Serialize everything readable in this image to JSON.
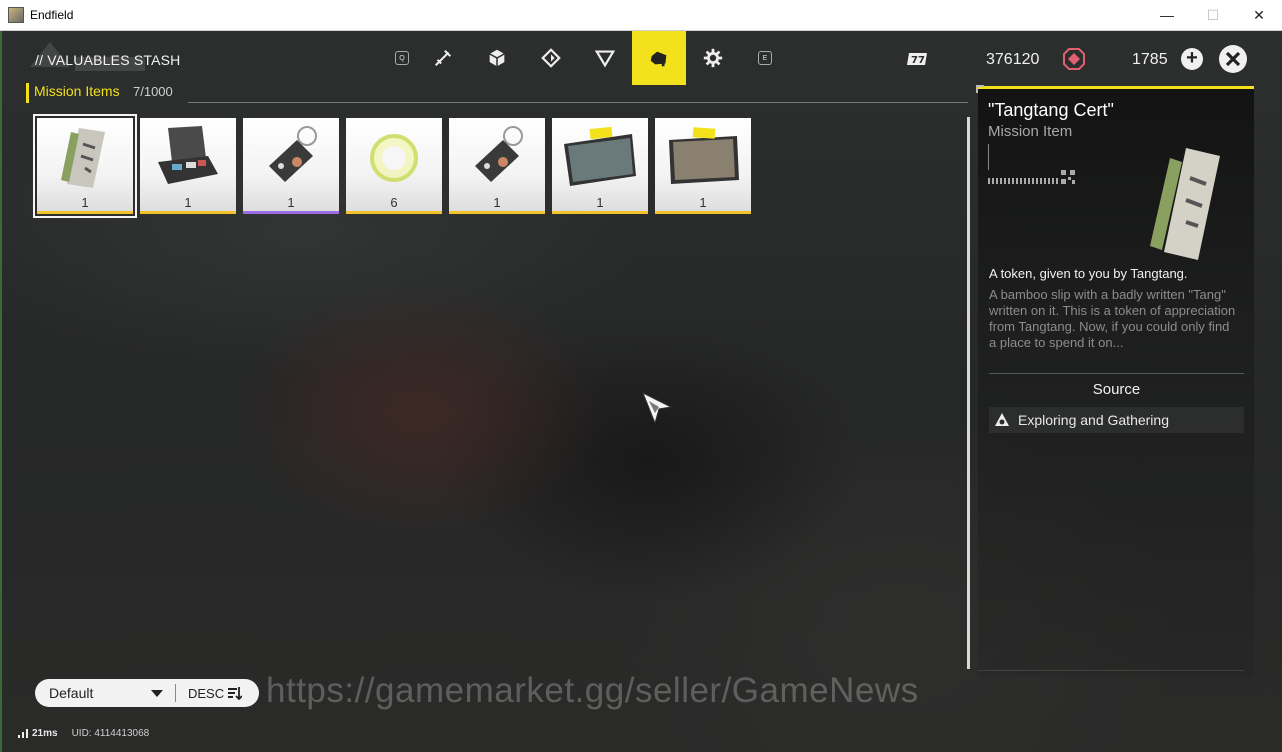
{
  "window": {
    "title": "Endfield",
    "minimize": "—",
    "maximize": "☐",
    "close": "✕"
  },
  "header": {
    "title": "// VALUABLES STASH"
  },
  "nav": {
    "key_left": "Q",
    "key_right": "E",
    "tabs": [
      {
        "icon": "weapon-icon",
        "active": false
      },
      {
        "icon": "cube-icon",
        "active": false
      },
      {
        "icon": "diamond-icon",
        "active": false
      },
      {
        "icon": "triangle-icon",
        "active": false
      },
      {
        "icon": "valuables-icon",
        "active": true
      },
      {
        "icon": "gear-icon",
        "active": false
      }
    ]
  },
  "currency": {
    "primary_value": "376120",
    "secondary_value": "1785",
    "primary_icon": "ticket-icon",
    "secondary_icon": "origeometry-icon"
  },
  "category": {
    "label": "Mission Items",
    "count": "7/1000"
  },
  "items": [
    {
      "name": "tangtang-cert",
      "quantity": "1",
      "rarity": "gold",
      "selected": true
    },
    {
      "name": "equipment-case",
      "quantity": "1",
      "rarity": "gold",
      "selected": false
    },
    {
      "name": "keychain-tag",
      "quantity": "1",
      "rarity": "purple",
      "selected": false
    },
    {
      "name": "glowing-ring",
      "quantity": "6",
      "rarity": "gold",
      "selected": false
    },
    {
      "name": "keychain-tag-2",
      "quantity": "1",
      "rarity": "gold",
      "selected": false
    },
    {
      "name": "photo-1",
      "quantity": "1",
      "rarity": "gold",
      "selected": false
    },
    {
      "name": "photo-2",
      "quantity": "1",
      "rarity": "gold",
      "selected": false
    }
  ],
  "detail": {
    "title": "\"Tangtang Cert\"",
    "subtitle": "Mission Item",
    "description_title": "A token, given to you by Tangtang.",
    "description": "A bamboo slip with a badly written \"Tang\" written on it. This is a token of appreciation from Tangtang. Now, if you could only find a place to spend it on...",
    "source_heading": "Source",
    "source_item": "Exploring and Gathering"
  },
  "sort": {
    "value": "Default",
    "order": "DESC"
  },
  "watermark": "https://gamemarket.gg/seller/GameNews",
  "status": {
    "ping": "21ms",
    "uid": "UID: 4114413068"
  },
  "colors": {
    "accent": "#f3e11b",
    "rarity_gold": "#f3c22b",
    "rarity_purple": "#9b6ee8"
  }
}
